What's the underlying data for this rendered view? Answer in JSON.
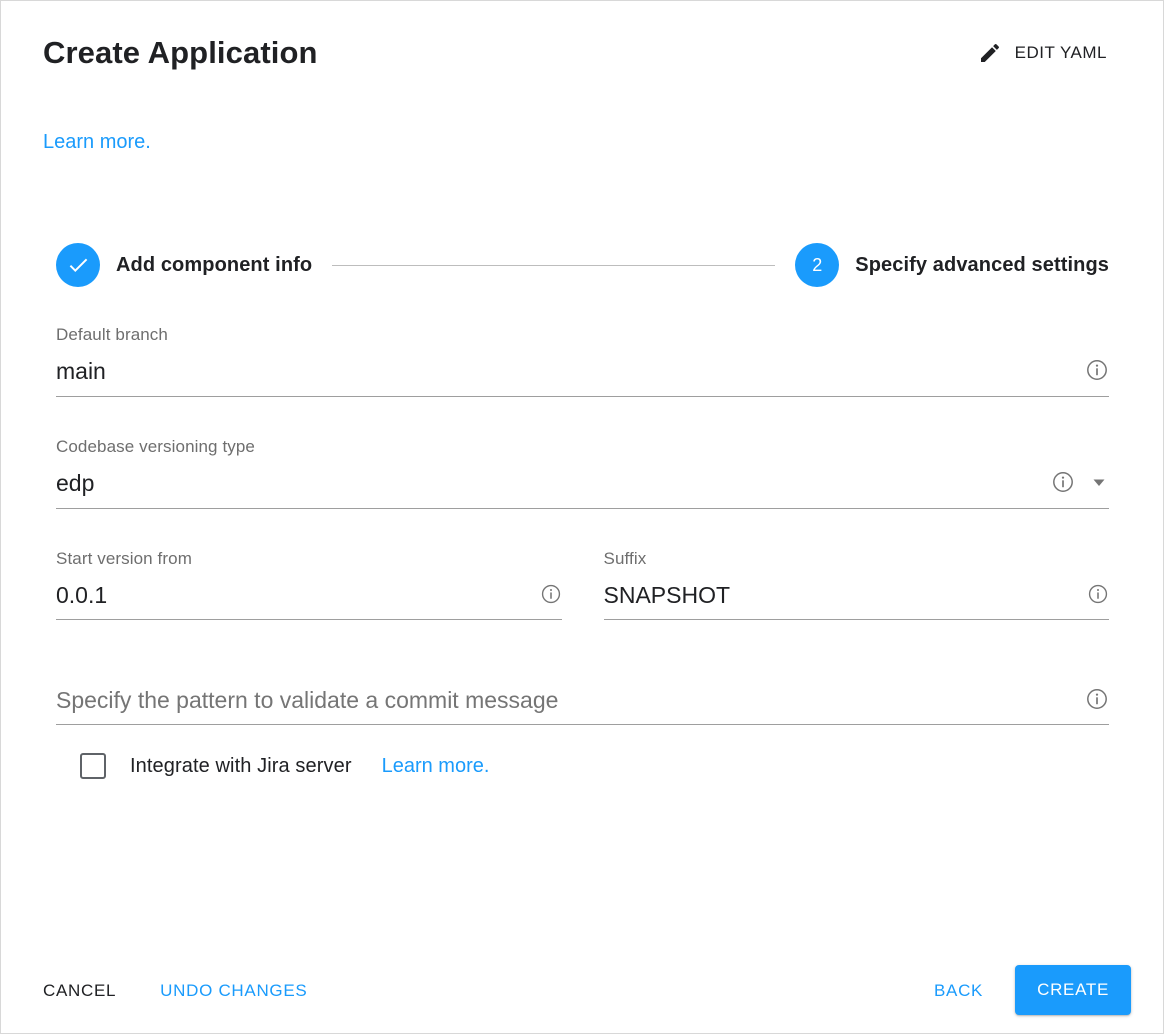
{
  "header": {
    "title": "Create Application",
    "edit_yaml_label": "EDIT YAML",
    "edit_yaml_icon": "pencil-icon"
  },
  "top_link": {
    "label": "Learn more."
  },
  "stepper": {
    "steps": [
      {
        "marker": "✓",
        "marker_type": "check",
        "label": "Add component info",
        "state": "completed"
      },
      {
        "marker": "2",
        "marker_type": "number",
        "label": "Specify advanced settings",
        "state": "active"
      }
    ]
  },
  "form": {
    "default_branch": {
      "label": "Default branch",
      "value": "main",
      "placeholder": "",
      "info_icon": "info-icon"
    },
    "codebase_versioning_type": {
      "label": "Codebase versioning type",
      "value": "edp",
      "placeholder": "",
      "info_icon": "info-icon",
      "caret_icon": "chevron-down-icon",
      "options": [
        "edp"
      ]
    },
    "start_version_from": {
      "label": "Start version from",
      "value": "0.0.1",
      "placeholder": "",
      "info_icon": "info-icon"
    },
    "suffix": {
      "label": "Suffix",
      "value": "SNAPSHOT",
      "placeholder": "",
      "info_icon": "info-icon"
    },
    "commit_message_pattern": {
      "label": "",
      "value": "",
      "placeholder": "Specify the pattern to validate a commit message",
      "info_icon": "info-icon"
    },
    "jira_integration": {
      "checked": false,
      "label": "Integrate with Jira server",
      "learn_more_label": "Learn more."
    }
  },
  "footer": {
    "cancel_label": "CANCEL",
    "undo_changes_label": "UNDO CHANGES",
    "back_label": "BACK",
    "create_label": "CREATE"
  },
  "colors": {
    "accent_blue": "#1a9bfc",
    "text_primary": "#202124",
    "text_secondary": "#6e6e6e",
    "underline": "#9e9e9e",
    "border": "#d8d8d8"
  }
}
